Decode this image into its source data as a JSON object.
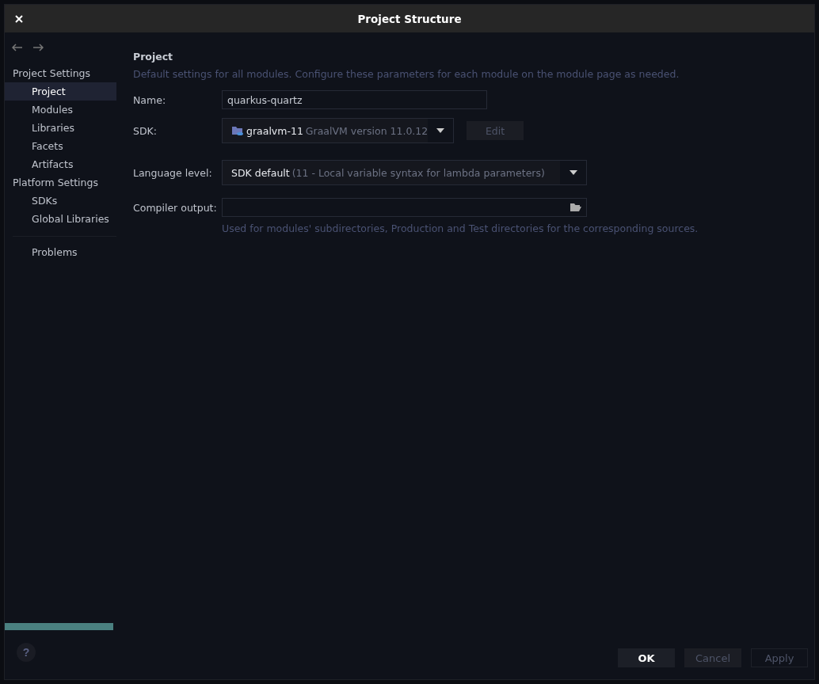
{
  "window": {
    "title": "Project Structure"
  },
  "sidebar": {
    "sections": [
      {
        "label": "Project Settings",
        "items": [
          {
            "label": "Project",
            "selected": true
          },
          {
            "label": "Modules",
            "selected": false
          },
          {
            "label": "Libraries",
            "selected": false
          },
          {
            "label": "Facets",
            "selected": false
          },
          {
            "label": "Artifacts",
            "selected": false
          }
        ]
      },
      {
        "label": "Platform Settings",
        "items": [
          {
            "label": "SDKs",
            "selected": false
          },
          {
            "label": "Global Libraries",
            "selected": false
          }
        ]
      }
    ],
    "extra_items": [
      {
        "label": "Problems",
        "selected": false
      }
    ]
  },
  "main": {
    "heading": "Project",
    "description": "Default settings for all modules. Configure these parameters for each module on the module page as needed.",
    "name_field": {
      "label": "Name:",
      "value": "quarkus-quartz"
    },
    "sdk": {
      "label": "SDK:",
      "name": "graalvm-11",
      "detail": "GraalVM version 11.0.12",
      "edit_button": {
        "label": "Edit",
        "disabled": true
      }
    },
    "language_level": {
      "label": "Language level:",
      "value": "SDK default",
      "detail": "(11 - Local variable syntax for lambda parameters)"
    },
    "compiler_output": {
      "label": "Compiler output:",
      "hint": "Used for modules' subdirectories, Production and Test directories for the corresponding sources."
    }
  },
  "help_button": {
    "label": "?"
  },
  "buttons": [
    {
      "label": "OK",
      "disabled": false
    },
    {
      "label": "Cancel",
      "disabled": true
    },
    {
      "label": "Apply",
      "disabled": true
    }
  ]
}
